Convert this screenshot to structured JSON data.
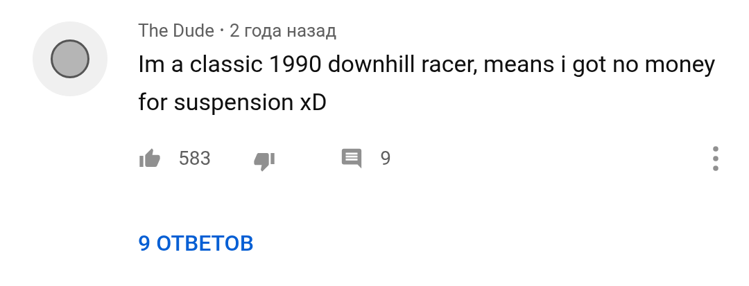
{
  "comment": {
    "author": "The Dude",
    "separator": "•",
    "time": "2 года назад",
    "text": "Im a classic 1990 downhill racer, means i got no money for suspension xD",
    "likes": "583",
    "replies_count": "9"
  },
  "replies_link": "9 ОТВЕТОВ"
}
